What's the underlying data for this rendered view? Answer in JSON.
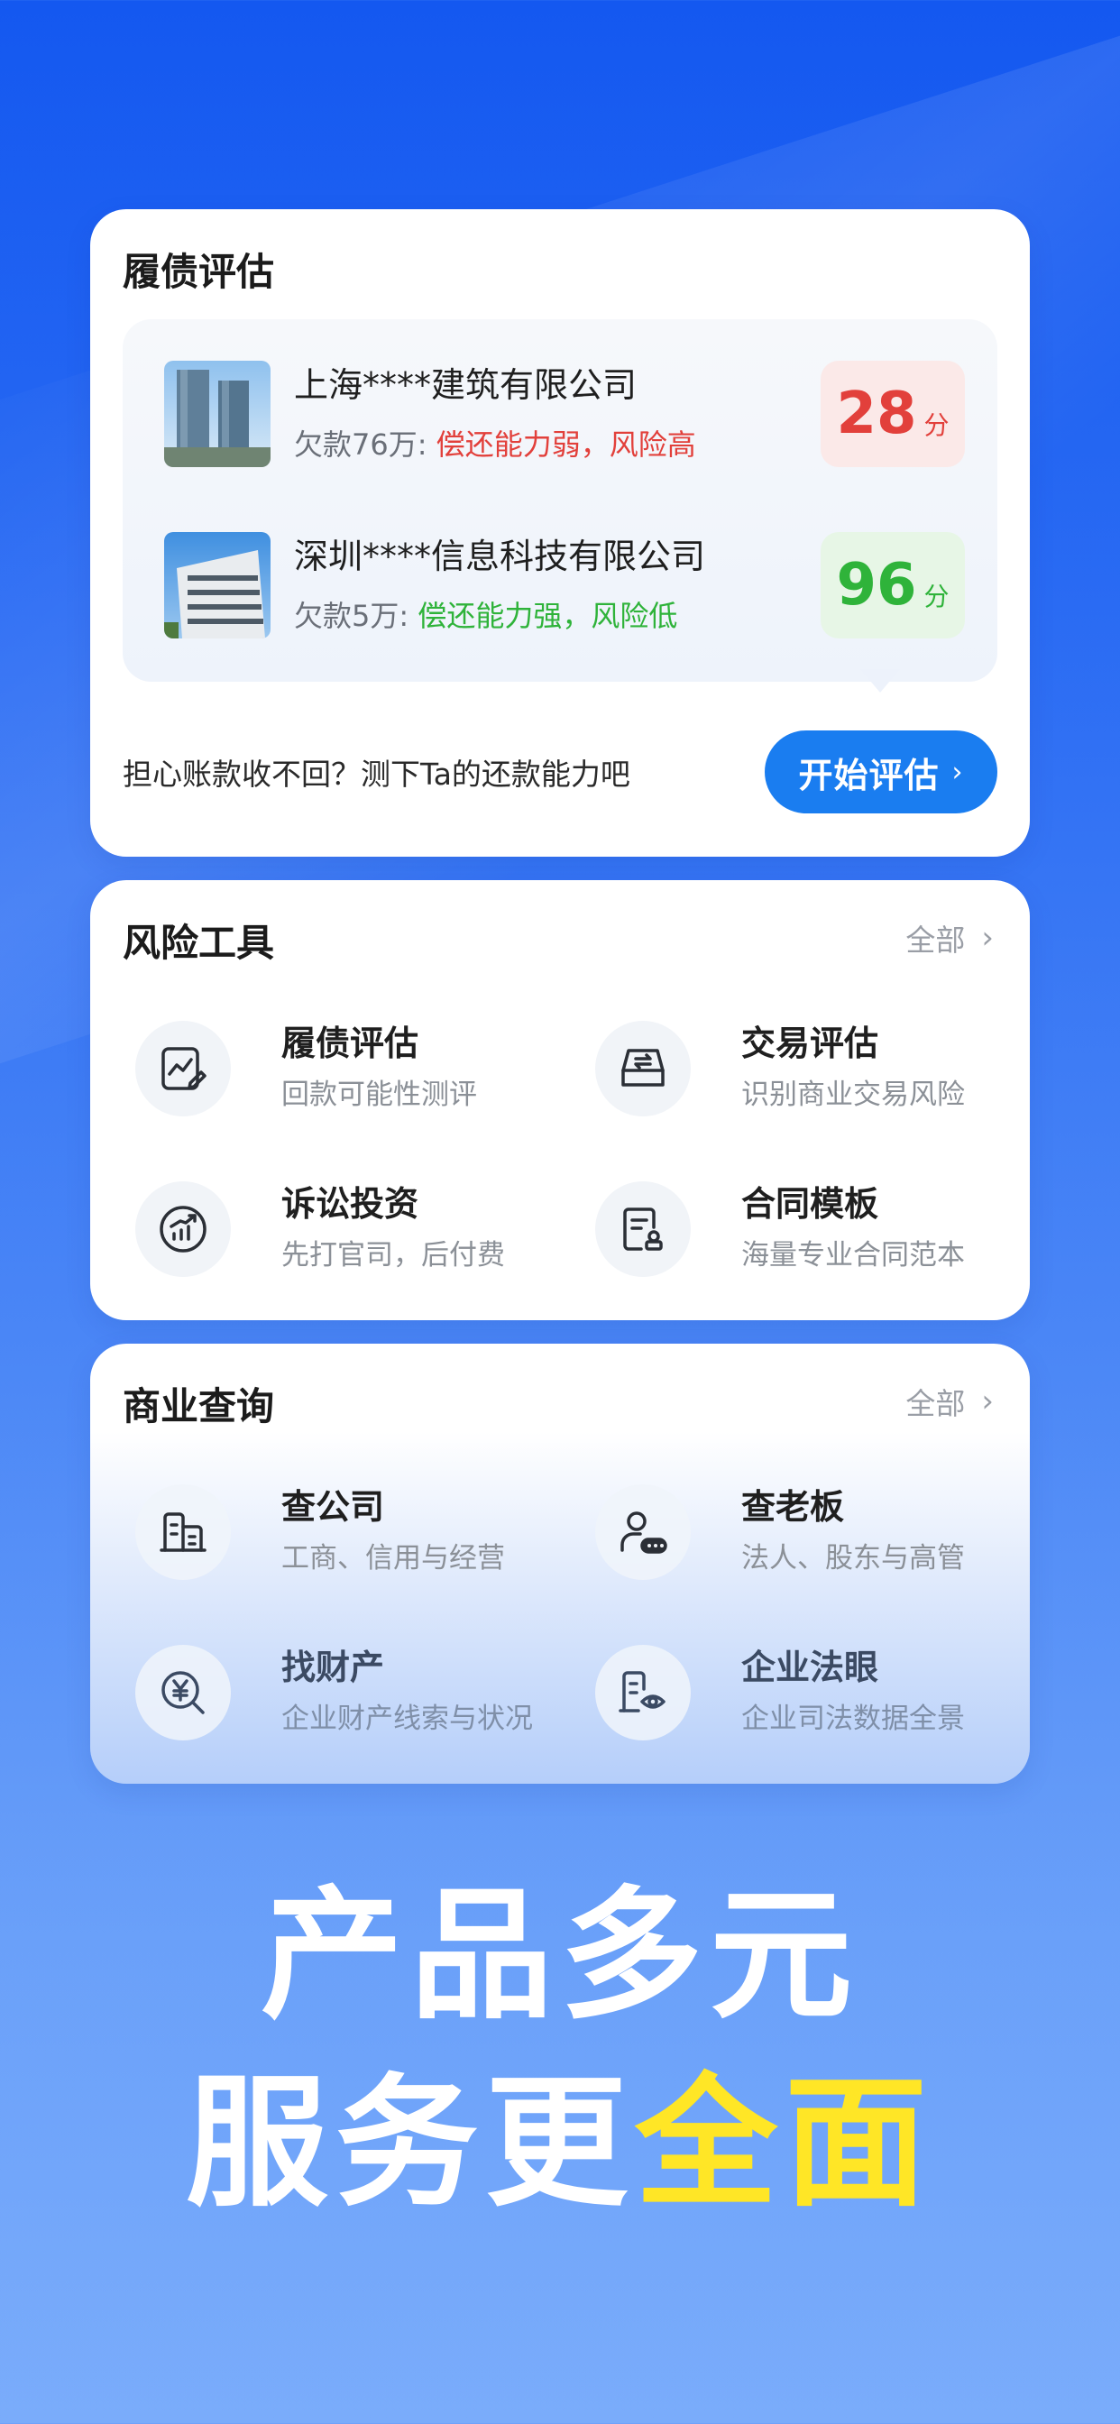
{
  "assessment_card": {
    "title": "履债评估",
    "companies": [
      {
        "name": "上海****建筑有限公司",
        "debt": "欠款76万: ",
        "verdict": "偿还能力弱，风险高",
        "score": "28",
        "unit": "分",
        "risk": "high"
      },
      {
        "name": "深圳****信息科技有限公司",
        "debt": "欠款5万: ",
        "verdict": "偿还能力强，风险低",
        "score": "96",
        "unit": "分",
        "risk": "low"
      }
    ],
    "prompt": "担心账款收不回？测下Ta的还款能力吧",
    "start_button": "开始评估",
    "chevron": "›"
  },
  "risk_tools": {
    "title": "风险工具",
    "all_label": "全部",
    "items": [
      {
        "title": "履债评估",
        "subtitle": "回款可能性测评",
        "icon": "chart-edit-icon"
      },
      {
        "title": "交易评估",
        "subtitle": "识别商业交易风险",
        "icon": "transaction-box-icon"
      },
      {
        "title": "诉讼投资",
        "subtitle": "先打官司，后付费",
        "icon": "growth-chart-icon"
      },
      {
        "title": "合同模板",
        "subtitle": "海量专业合同范本",
        "icon": "contract-doc-icon"
      }
    ]
  },
  "business_query": {
    "title": "商业查询",
    "all_label": "全部",
    "items": [
      {
        "title": "查公司",
        "subtitle": "工商、信用与经营",
        "icon": "building-icon"
      },
      {
        "title": "查老板",
        "subtitle": "法人、股东与高管",
        "icon": "person-card-icon"
      },
      {
        "title": "找财产",
        "subtitle": "企业财产线索与状况",
        "icon": "yuan-search-icon"
      },
      {
        "title": "企业法眼",
        "subtitle": "企业司法数据全景",
        "icon": "building-eye-icon"
      }
    ]
  },
  "headline": {
    "line1": "产品多元",
    "line2_white": "服务更",
    "line2_yellow": "全面"
  },
  "colors": {
    "accent": "#1a7df0",
    "risk_high": "#e2403b",
    "risk_low": "#2fb33a",
    "headline_highlight": "#ffe626"
  }
}
